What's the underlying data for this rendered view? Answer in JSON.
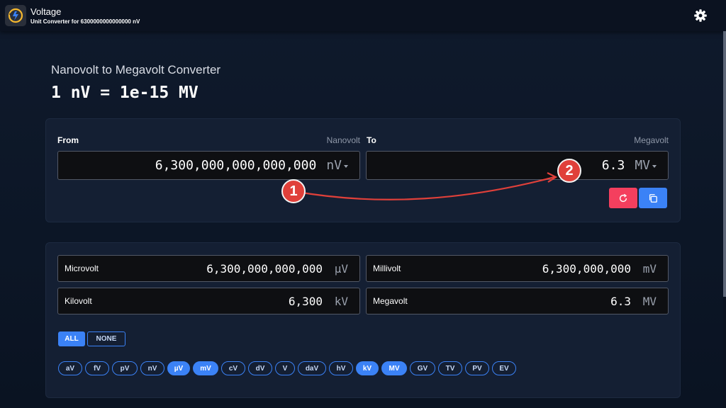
{
  "header": {
    "title": "Voltage",
    "subtitle": "Unit Converter for 6300000000000000 nV"
  },
  "page": {
    "heading": "Nanovolt to Megavolt Converter",
    "formula": "1 nV = 1e-15 MV"
  },
  "converter": {
    "from_label": "From",
    "from_unit_name": "Nanovolt",
    "from_value": "6,300,000,000,000,000",
    "from_unit": "nV",
    "to_label": "To",
    "to_unit_name": "Megavolt",
    "to_value": "6.3",
    "to_unit": "MV"
  },
  "results": [
    {
      "name": "Microvolt",
      "value": "6,300,000,000,000",
      "unit": "µV"
    },
    {
      "name": "Millivolt",
      "value": "6,300,000,000",
      "unit": "mV"
    },
    {
      "name": "Kilovolt",
      "value": "6,300",
      "unit": "kV"
    },
    {
      "name": "Megavolt",
      "value": "6.3",
      "unit": "MV"
    }
  ],
  "filters": {
    "all_label": "ALL",
    "none_label": "NONE"
  },
  "chips": [
    {
      "label": "aV",
      "selected": false
    },
    {
      "label": "fV",
      "selected": false
    },
    {
      "label": "pV",
      "selected": false
    },
    {
      "label": "nV",
      "selected": false
    },
    {
      "label": "µV",
      "selected": true
    },
    {
      "label": "mV",
      "selected": true
    },
    {
      "label": "cV",
      "selected": false
    },
    {
      "label": "dV",
      "selected": false
    },
    {
      "label": "V",
      "selected": false
    },
    {
      "label": "daV",
      "selected": false
    },
    {
      "label": "hV",
      "selected": false
    },
    {
      "label": "kV",
      "selected": true
    },
    {
      "label": "MV",
      "selected": true
    },
    {
      "label": "GV",
      "selected": false
    },
    {
      "label": "TV",
      "selected": false
    },
    {
      "label": "PV",
      "selected": false
    },
    {
      "label": "EV",
      "selected": false
    }
  ],
  "annotations": [
    {
      "label": "1"
    },
    {
      "label": "2"
    }
  ],
  "icons": {
    "logo": "voltage-logo-icon",
    "settings": "gear-icon",
    "reset": "refresh-icon",
    "copy": "copy-icon"
  },
  "colors": {
    "accent": "#3b82f6",
    "reset": "#f43f5e",
    "annotation": "#e0403a"
  }
}
